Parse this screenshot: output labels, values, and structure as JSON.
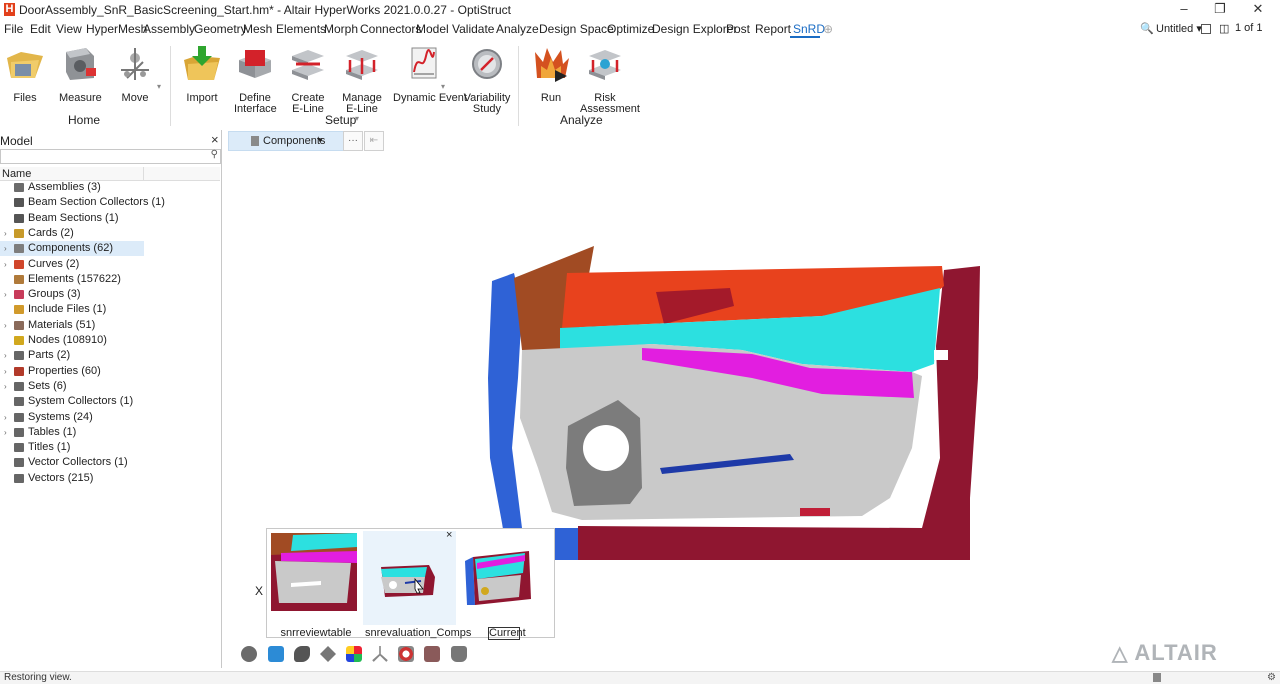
{
  "window": {
    "title": "DoorAssembly_SnR_BasicScreening_Start.hm* - Altair HyperWorks 2021.0.0.27 - OptiStruct",
    "minimize": "–",
    "restore": "❐",
    "close": "✕"
  },
  "menu": {
    "items": [
      "File",
      "Edit",
      "View",
      "HyperMesh",
      "Assembly",
      "Geometry",
      "Mesh",
      "Elements",
      "Morph",
      "Connectors",
      "Model",
      "Validate",
      "Analyze",
      "Design Space",
      "Optimize",
      "Design Explorer",
      "Post",
      "Report",
      "SnRD"
    ],
    "active": "SnRD",
    "add_tab": "⊕",
    "session_name": "Untitled ▾",
    "page_counter": "1 of 1"
  },
  "ribbon": {
    "home": {
      "label": "Home",
      "tools": [
        "Files",
        "Measure",
        "Move"
      ]
    },
    "setup": {
      "label": "Setup",
      "tools": [
        "Import",
        "Define Interface",
        "Create E-Line",
        "Manage E-Line",
        "Dynamic Event",
        "Variability Study"
      ]
    },
    "analyze": {
      "label": "Analyze",
      "tools": [
        "Run",
        "Risk Assessment"
      ]
    }
  },
  "model_browser": {
    "header": "Model",
    "column_name": "Name",
    "search_placeholder": "",
    "items": [
      {
        "label": "Assemblies  (3)",
        "icon": "assembly-icon",
        "color": "#6b6b6b",
        "expand": false
      },
      {
        "label": "Beam Section Collectors  (1)",
        "icon": "beam-section-collector-icon",
        "color": "#555555",
        "expand": false
      },
      {
        "label": "Beam Sections  (1)",
        "icon": "beam-section-icon",
        "color": "#555555",
        "expand": false
      },
      {
        "label": "Cards  (2)",
        "icon": "card-icon",
        "color": "#c79a2a",
        "expand": true
      },
      {
        "label": "Components  (62)",
        "icon": "component-icon",
        "color": "#7d7d7d",
        "expand": true,
        "selected": true
      },
      {
        "label": "Curves  (2)",
        "icon": "curve-icon",
        "color": "#d1462b",
        "expand": true
      },
      {
        "label": "Elements  (157622)",
        "icon": "element-icon",
        "color": "#b07a3a",
        "expand": false
      },
      {
        "label": "Groups  (3)",
        "icon": "group-icon",
        "color": "#c83b5a",
        "expand": true
      },
      {
        "label": "Include Files  (1)",
        "icon": "include-file-icon",
        "color": "#d19a2b",
        "expand": false
      },
      {
        "label": "Materials  (51)",
        "icon": "material-icon",
        "color": "#8a6a5a",
        "expand": true
      },
      {
        "label": "Nodes  (108910)",
        "icon": "node-icon",
        "color": "#d1a81e",
        "expand": false
      },
      {
        "label": "Parts  (2)",
        "icon": "part-icon",
        "color": "#666666",
        "expand": true
      },
      {
        "label": "Properties  (60)",
        "icon": "property-icon",
        "color": "#b23a2a",
        "expand": true
      },
      {
        "label": "Sets  (6)",
        "icon": "set-icon",
        "color": "#666666",
        "expand": true
      },
      {
        "label": "System Collectors  (1)",
        "icon": "system-collector-icon",
        "color": "#666666",
        "expand": false
      },
      {
        "label": "Systems  (24)",
        "icon": "system-icon",
        "color": "#666666",
        "expand": true
      },
      {
        "label": "Tables  (1)",
        "icon": "table-icon",
        "color": "#666666",
        "expand": true
      },
      {
        "label": "Titles  (1)",
        "icon": "title-icon",
        "color": "#666666",
        "expand": false
      },
      {
        "label": "Vector Collectors  (1)",
        "icon": "vector-collector-icon",
        "color": "#666666",
        "expand": false
      },
      {
        "label": "Vectors  (215)",
        "icon": "vector-icon",
        "color": "#666666",
        "expand": false
      }
    ]
  },
  "viewport": {
    "entity_selector": "Components",
    "more_button": "···",
    "collapse_button": "⇤"
  },
  "views_panel": {
    "close_x": "X",
    "thumb_close": "×",
    "thumbnails": [
      {
        "caption": "snrreviewtable"
      },
      {
        "caption": "snrevaluation_Comps"
      },
      {
        "caption": "Current"
      }
    ]
  },
  "brand": "ALTAIR",
  "status": {
    "text": "Restoring view."
  },
  "colors": {
    "accent": "#1a6cc4",
    "selection": "#dcebf9",
    "door_blue": "#2f62d6",
    "door_maroon": "#8f1630",
    "door_orange": "#e8421d",
    "door_cyan": "#2ce0e0",
    "door_magenta": "#e21ee0",
    "door_grey": "#c9c9c9"
  }
}
